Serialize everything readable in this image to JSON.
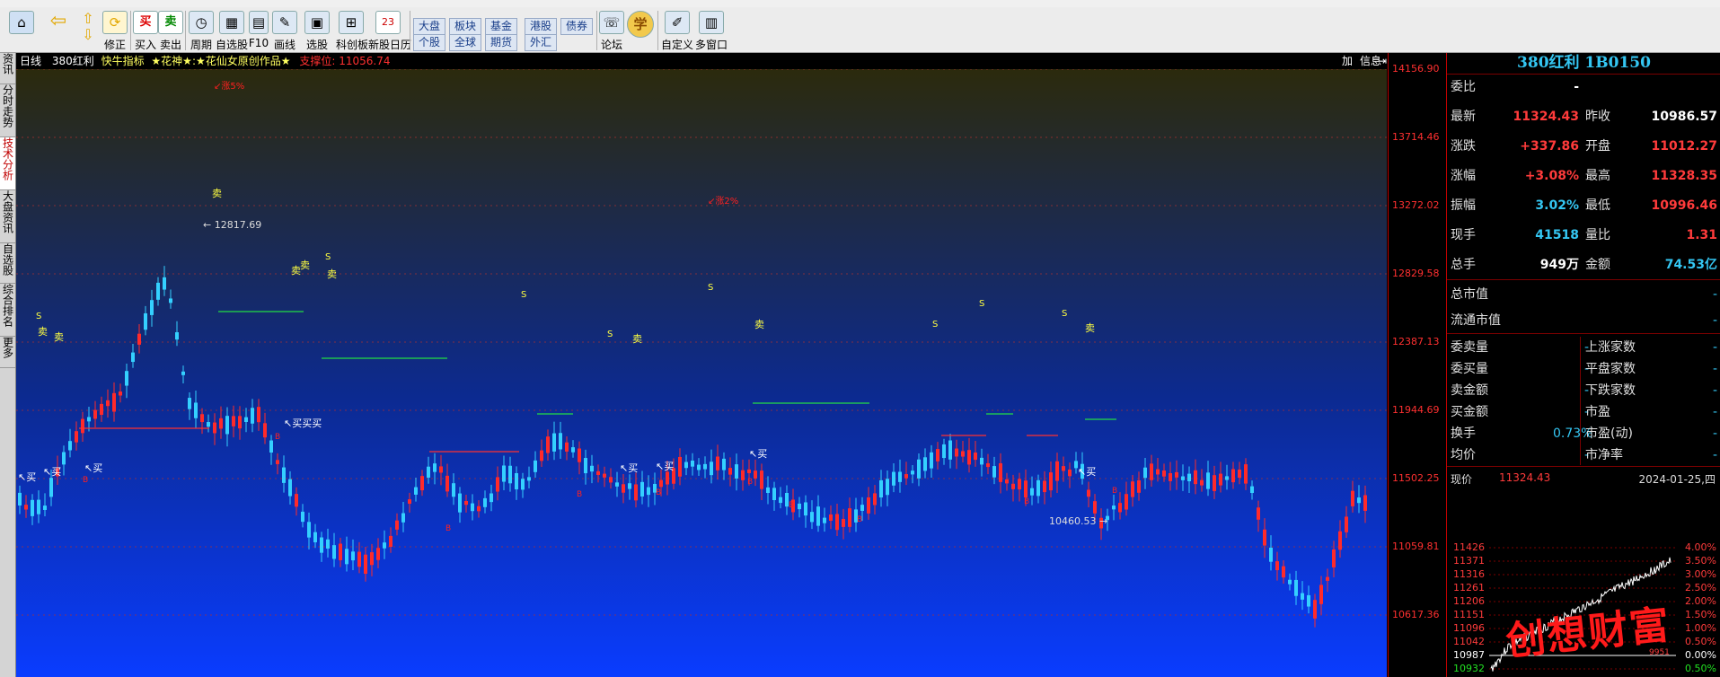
{
  "toolbar": {
    "items": [
      {
        "icon": "home-icon",
        "label": ""
      },
      {
        "icon": "back-arrow-icon",
        "label": ""
      },
      {
        "icon": "updown-arrows-icon",
        "label": ""
      },
      {
        "icon": "fix-icon",
        "label": "修正"
      },
      {
        "icon": "buy-icon",
        "label": "买入",
        "glyph": "买"
      },
      {
        "icon": "sell-icon",
        "label": "卖出",
        "glyph": "卖"
      },
      {
        "icon": "clock-icon",
        "label": "周期"
      },
      {
        "icon": "watchlist-icon",
        "label": "自选股"
      },
      {
        "icon": "f10-icon",
        "label": "F10"
      },
      {
        "icon": "pen-icon",
        "label": "画线"
      },
      {
        "icon": "stock-picker-icon",
        "label": "选股"
      },
      {
        "icon": "star-board-icon",
        "label": "科创板"
      },
      {
        "icon": "calendar-icon",
        "label": "新股日历",
        "glyph": "23"
      },
      {
        "icon": "forum-icon",
        "label": "论坛"
      },
      {
        "icon": "learn-icon",
        "label": "",
        "glyph": "学"
      },
      {
        "icon": "customize-icon",
        "label": "自定义"
      },
      {
        "icon": "multi-window-icon",
        "label": "多窗口"
      }
    ],
    "markets": [
      {
        "label": "大盘"
      },
      {
        "label": "板块"
      },
      {
        "label": "基金"
      },
      {
        "label": "港股"
      },
      {
        "label": "债券"
      },
      {
        "label": "个股"
      },
      {
        "label": "全球"
      },
      {
        "label": "期货"
      },
      {
        "label": "外汇"
      }
    ]
  },
  "left_tabs": [
    "资讯",
    "分时走势",
    "技术分析",
    "大盘资讯",
    "自选股",
    "综合排名",
    "更多"
  ],
  "chart_header": {
    "period": "日线",
    "name": "380红利",
    "indicator": "快牛指标",
    "author": "★花神★:★花仙女原创作品★",
    "support_label": "支撑位:",
    "support_value": "11056.74",
    "btn_add": "加",
    "btn_info": "信息"
  },
  "price_axis": [
    "14156.90",
    "13714.46",
    "13272.02",
    "12829.58",
    "12387.13",
    "11944.69",
    "11502.25",
    "11059.81",
    "10617.36"
  ],
  "chart_annotations": {
    "high": "12817.69",
    "low": "10460.53",
    "pct_left": "↙涨5%",
    "pct_right": "↙涨2%",
    "buy": "买",
    "sell": "卖",
    "s": "S",
    "b": "B",
    "multi_buy": "买买买"
  },
  "quote": {
    "title": "380红利  1B0150",
    "rows": [
      {
        "k": "委比",
        "v": "-",
        "v_color": "white",
        "k2": "",
        "v2": ""
      },
      {
        "k": "最新",
        "v": "11324.43",
        "v_color": "red",
        "k2": "昨收",
        "v2": "10986.57",
        "v2_color": "white"
      },
      {
        "k": "涨跌",
        "v": "+337.86",
        "v_color": "red",
        "k2": "开盘",
        "v2": "11012.27",
        "v2_color": "red"
      },
      {
        "k": "涨幅",
        "v": "+3.08%",
        "v_color": "red",
        "k2": "最高",
        "v2": "11328.35",
        "v2_color": "red"
      },
      {
        "k": "振幅",
        "v": "3.02%",
        "v_color": "cyan",
        "k2": "最低",
        "v2": "10996.46",
        "v2_color": "red"
      },
      {
        "k": "现手",
        "v": "41518",
        "v_color": "cyan",
        "k2": "量比",
        "v2": "1.31",
        "v2_color": "red"
      },
      {
        "k": "总手",
        "v": "949万",
        "v_color": "white",
        "k2": "金额",
        "v2": "74.53亿",
        "v2_color": "cyan"
      }
    ],
    "mcap": [
      {
        "k": "总市值",
        "v": "-"
      },
      {
        "k": "流通市值",
        "v": "-"
      }
    ],
    "grid": [
      {
        "k": "委卖量",
        "v": "-",
        "k2": "上涨家数",
        "v2": "-"
      },
      {
        "k": "委买量",
        "v": "-",
        "k2": "平盘家数",
        "v2": "-"
      },
      {
        "k": "卖金额",
        "v": "-",
        "k2": "下跌家数",
        "v2": "-"
      },
      {
        "k": "买金额",
        "v": "-",
        "k2": "市盈",
        "v2": "-"
      },
      {
        "k": "换手",
        "v": "0.73%",
        "k2": "市盈(动)",
        "v2": "-"
      },
      {
        "k": "均价",
        "v": "-",
        "k2": "市净率",
        "v2": "-"
      }
    ]
  },
  "mini": {
    "price_label": "现价",
    "price": "11324.43",
    "date": "2024-01-25,四",
    "left_ticks": [
      "11426",
      "11371",
      "11316",
      "11261",
      "11206",
      "11151",
      "11096",
      "11042",
      "10987",
      "10932"
    ],
    "right_ticks": [
      "4.00%",
      "3.50%",
      "3.00%",
      "2.50%",
      "2.00%",
      "1.50%",
      "1.00%",
      "0.50%",
      "0.00%",
      "0.50%"
    ],
    "watermark": "创想财富",
    "small_value": "9951"
  }
}
